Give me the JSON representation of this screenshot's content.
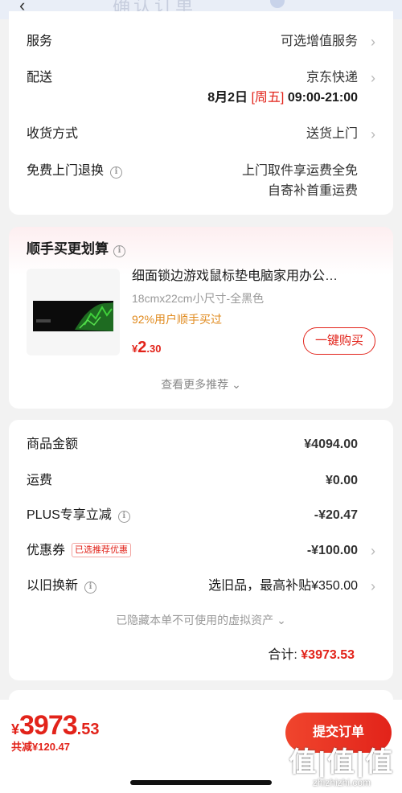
{
  "header": {
    "back_icon": "‹",
    "title": "确认订单"
  },
  "delivery": {
    "service": {
      "label": "服务",
      "value": "可选增值服务"
    },
    "shipping": {
      "label": "配送",
      "carrier": "京东快递",
      "date": "8月2日",
      "weekday": "[周五]",
      "time": "09:00-21:00"
    },
    "receive": {
      "label": "收货方式",
      "value": "送货上门"
    },
    "returns": {
      "label": "免费上门退换",
      "line1": "上门取件享运费全免",
      "line2": "自寄补首重运费"
    }
  },
  "recommend": {
    "title": "顺手买更划算",
    "product": {
      "name": "细面锁边游戏鼠标垫电脑家用办公…",
      "spec": "18cmx22cm小尺寸-全黑色",
      "social": "92%用户顺手买过",
      "price_symbol": "¥",
      "price_int": "2",
      "price_dec": ".30",
      "buy_label": "一键购买"
    },
    "more_label": "查看更多推荐 ⌄"
  },
  "summary": {
    "goods": {
      "label": "商品金额",
      "value": "¥4094.00"
    },
    "freight": {
      "label": "运费",
      "value": "¥0.00"
    },
    "plus": {
      "label": "PLUS专享立减",
      "value": "-¥20.47"
    },
    "coupon": {
      "label": "优惠券",
      "tag": "已选推荐优惠",
      "value": "-¥100.00"
    },
    "tradein": {
      "label": "以旧换新",
      "value": "选旧品，最高补贴¥350.00"
    },
    "hidden_note": "已隐藏本单不可使用的虚拟资产 ⌄",
    "total_label": "合计:",
    "total_value": "¥3973.53"
  },
  "bottom": {
    "currency": "¥",
    "price_int": "3973",
    "price_dec": ".53",
    "saved": "共减¥120.47",
    "submit_label": "提交订单"
  },
  "watermark": {
    "big": "值|值|值",
    "small": "zhizhizhi.com"
  },
  "colors": {
    "accent": "#e2231a",
    "social": "#e08a1e"
  }
}
